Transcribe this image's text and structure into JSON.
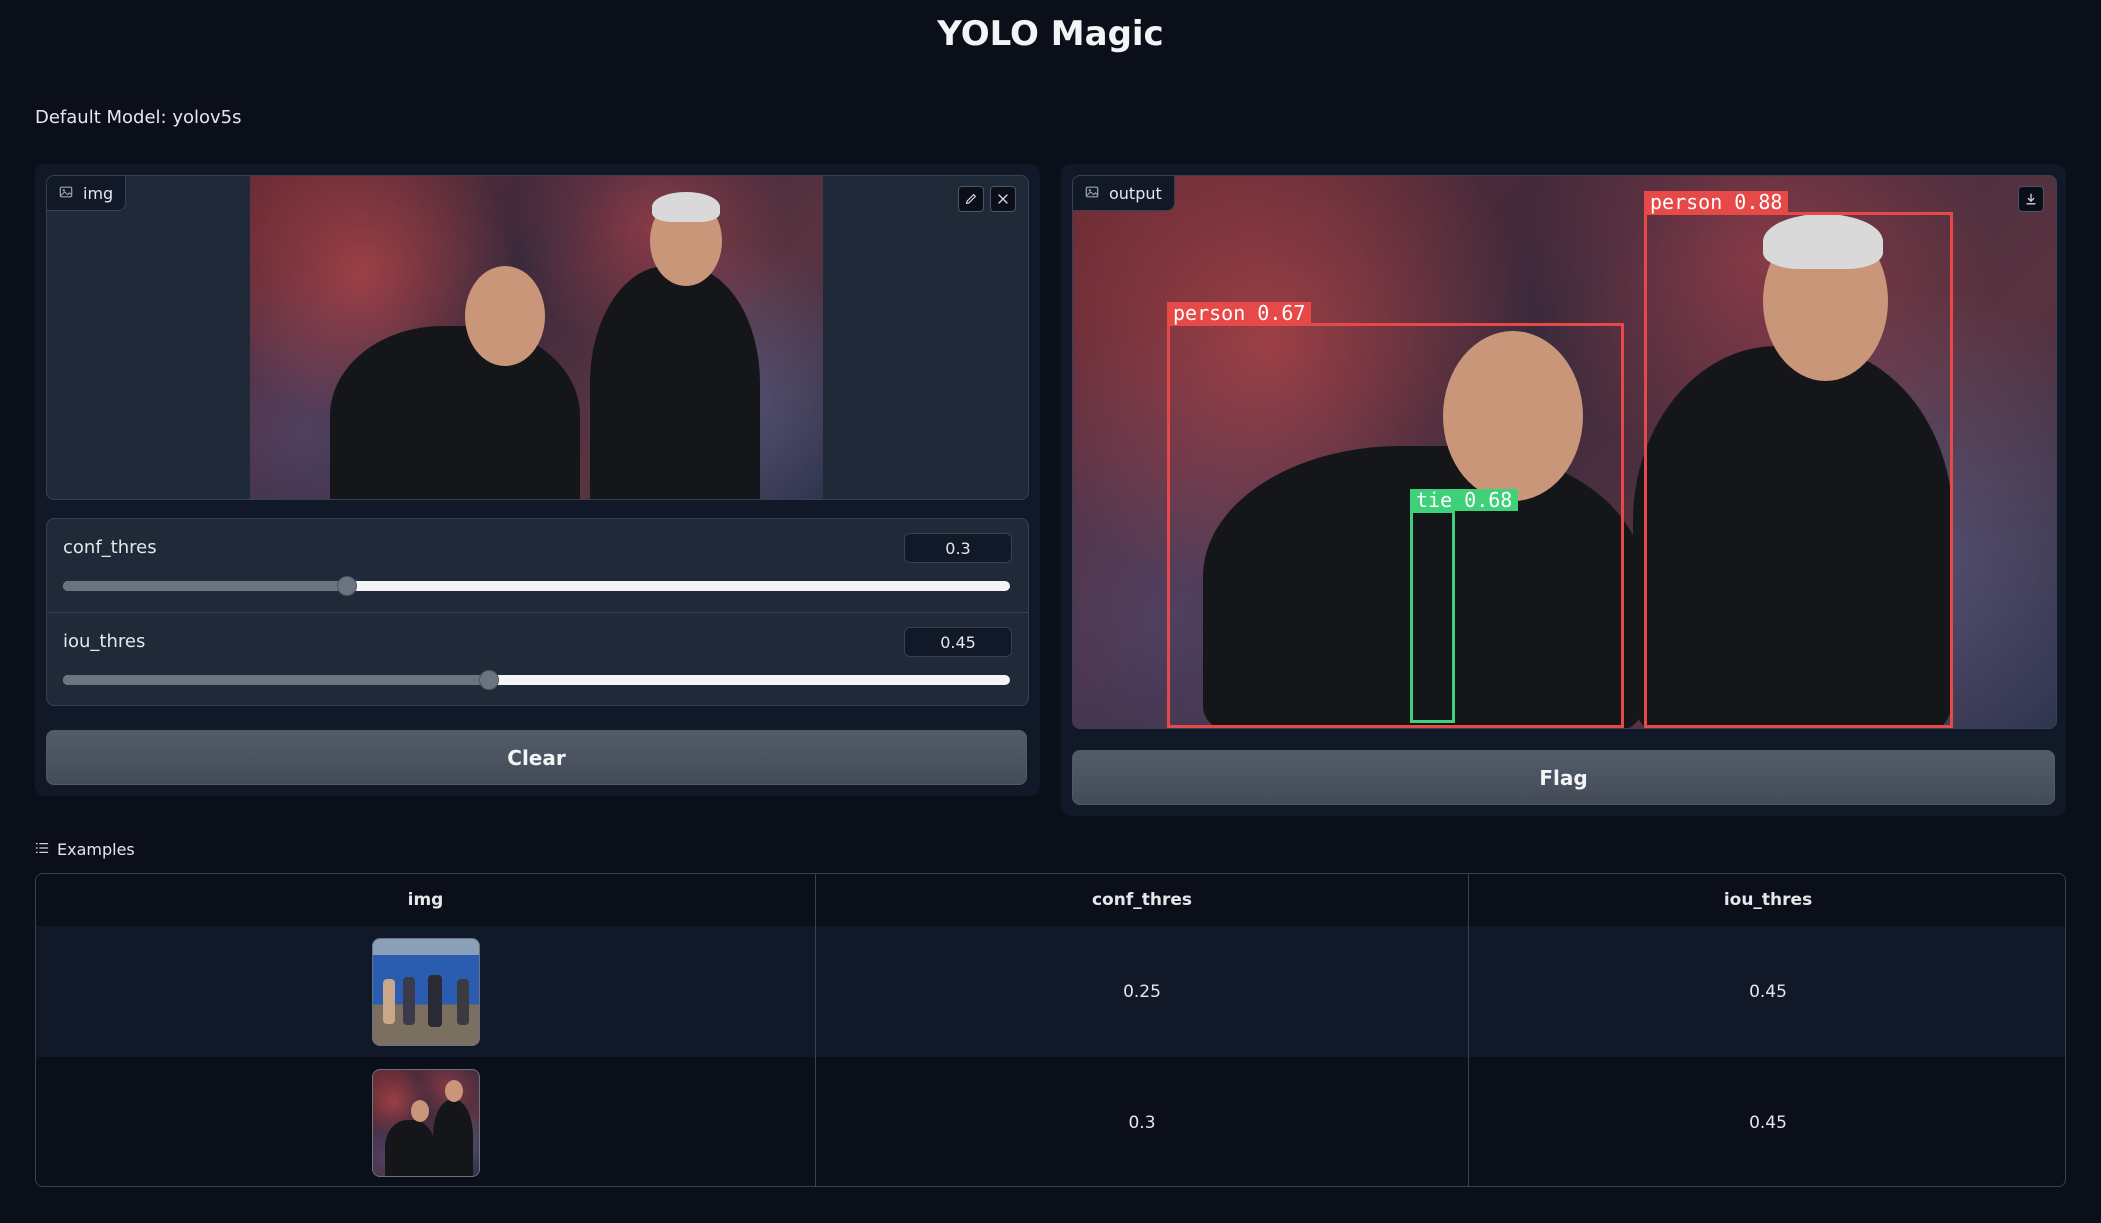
{
  "app": {
    "title": "YOLO Magic",
    "default_model": "Default Model: yolov5s"
  },
  "input": {
    "image_label": "img",
    "edit_icon": "pencil-icon",
    "clear_icon": "close-icon",
    "sliders": [
      {
        "label": "conf_thres",
        "value": "0.3",
        "fraction": 0.3
      },
      {
        "label": "iou_thres",
        "value": "0.45",
        "fraction": 0.45
      }
    ],
    "clear_button": "Clear"
  },
  "output": {
    "image_label": "output",
    "download_icon": "download-icon",
    "detections": [
      {
        "label": "person  0.88",
        "color": "#e74848"
      },
      {
        "label": "person  0.67",
        "color": "#e74848"
      },
      {
        "label": "tie  0.68",
        "color": "#3fd07a"
      }
    ],
    "flag_button": "Flag"
  },
  "examples": {
    "title": "Examples",
    "columns": [
      "img",
      "conf_thres",
      "iou_thres"
    ],
    "rows": [
      {
        "conf_thres": "0.25",
        "iou_thres": "0.45"
      },
      {
        "conf_thres": "0.3",
        "iou_thres": "0.45"
      }
    ]
  },
  "colors": {
    "background": "#0b0f19",
    "panel": "#111827",
    "box_red": "#e74848",
    "box_green": "#3fd07a"
  }
}
